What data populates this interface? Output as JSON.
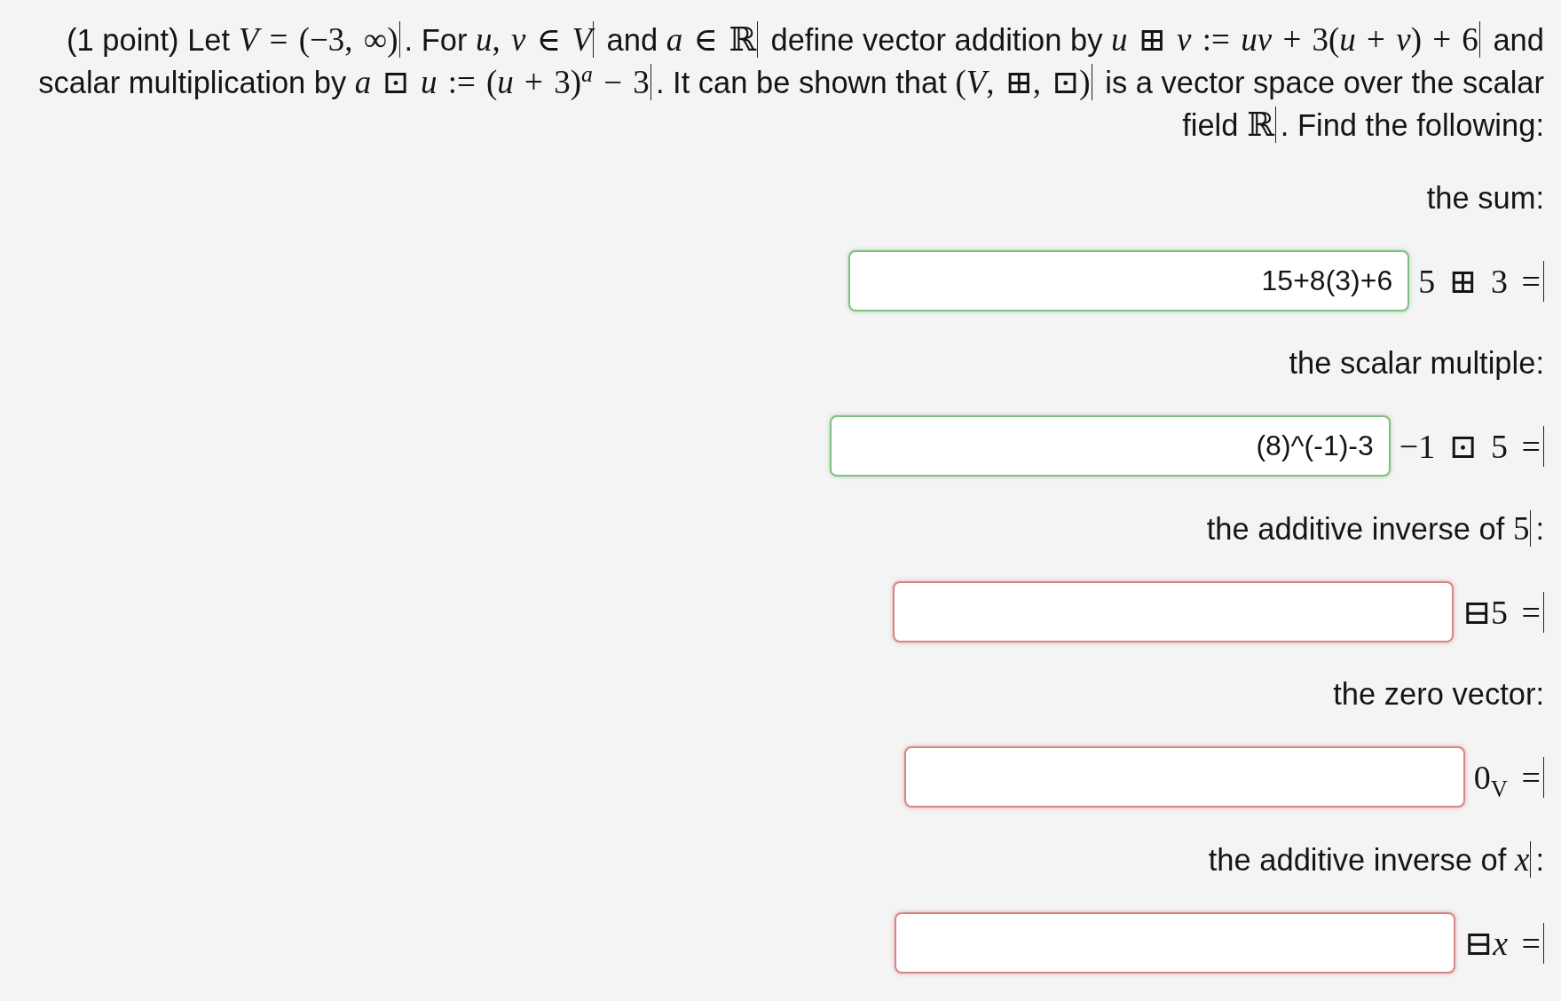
{
  "problem": {
    "segments": [
      {
        "kind": "text",
        "text": "(1 point) Let "
      },
      {
        "kind": "math",
        "text": "*V* = (−3, ∞)"
      },
      {
        "kind": "text",
        "text": ". For "
      },
      {
        "kind": "math",
        "text": "*u*, *v* ∈ *V*"
      },
      {
        "kind": "text",
        "text": " and "
      },
      {
        "kind": "math",
        "text": "*a* ∈ ℝ"
      },
      {
        "kind": "text",
        "text": " define vector addition by "
      },
      {
        "kind": "math",
        "text": "*u* ⊞ *v* := *uv* + 3(*u* + *v*) + 6"
      },
      {
        "kind": "text",
        "text": " and scalar multiplication by "
      },
      {
        "kind": "math",
        "text": "*a* ⊡ *u* := (*u* + 3)$^{a}$ − 3"
      },
      {
        "kind": "text",
        "text": ". It can be shown that "
      },
      {
        "kind": "math",
        "text": "(*V*, ⊞, ⊡)"
      },
      {
        "kind": "text",
        "text": " is a vector space over the scalar field "
      },
      {
        "kind": "math",
        "text": "ℝ"
      },
      {
        "kind": "text",
        "text": ". Find the following:"
      }
    ]
  },
  "answers": [
    {
      "prompt": [
        {
          "kind": "text",
          "text": "the sum:"
        }
      ],
      "equation": "5 ⊞ 3 =",
      "value": "15+8(3)+6",
      "correct": true
    },
    {
      "prompt": [
        {
          "kind": "text",
          "text": "the scalar multiple:"
        }
      ],
      "equation": "−1 ⊡ 5 =",
      "value": "(8)^(-1)-3",
      "correct": true
    },
    {
      "prompt": [
        {
          "kind": "text",
          "text": "the additive inverse of "
        },
        {
          "kind": "math",
          "text": "5"
        },
        {
          "kind": "text",
          "text": ":"
        }
      ],
      "equation": "⊟5 =",
      "correct": false
    },
    {
      "prompt": [
        {
          "kind": "text",
          "text": "the zero vector:"
        }
      ],
      "equation": "0$_{V}$ =",
      "correct": false
    },
    {
      "prompt": [
        {
          "kind": "text",
          "text": "the additive inverse of "
        },
        {
          "kind": "math",
          "text": "*x*"
        },
        {
          "kind": "text",
          "text": ":"
        }
      ],
      "equation": "⊟*x* =",
      "correct": false
    }
  ]
}
